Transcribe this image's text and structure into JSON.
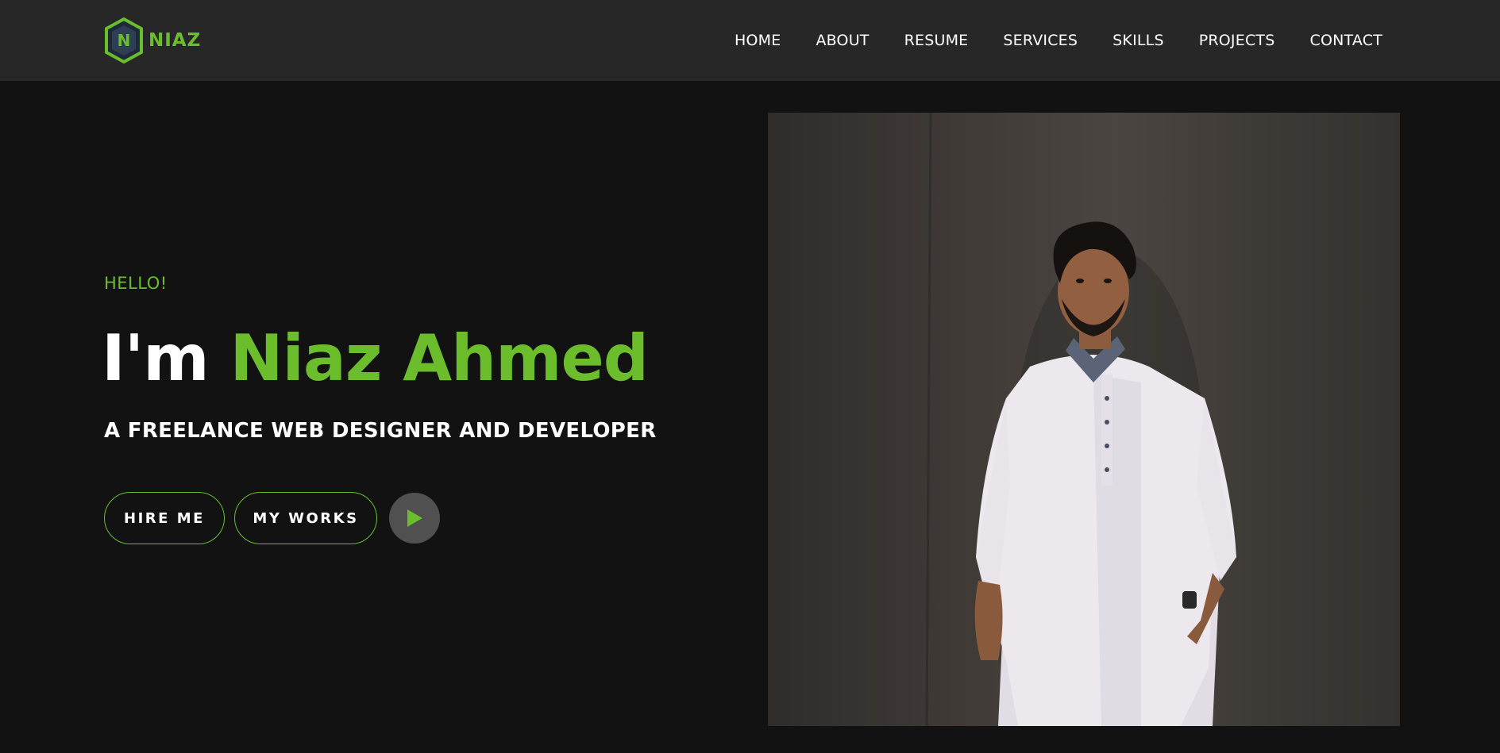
{
  "brand": {
    "logo_letter": "N",
    "name": "NIAZ",
    "accent_color": "#6bbd2c"
  },
  "nav": {
    "items": [
      {
        "label": "HOME"
      },
      {
        "label": "ABOUT"
      },
      {
        "label": "RESUME"
      },
      {
        "label": "SERVICES"
      },
      {
        "label": "SKILLS"
      },
      {
        "label": "PROJECTS"
      },
      {
        "label": "CONTACT"
      }
    ]
  },
  "hero": {
    "greeting": "HELLO!",
    "headline_prefix": "I'm",
    "headline_name": "Niaz Ahmed",
    "subtitle": "A FREELANCE WEB DESIGNER AND DEVELOPER",
    "hire_label": "HIRE ME",
    "works_label": "MY WORKS",
    "play_icon": "play-icon"
  },
  "photo": {
    "icon": "portrait-photo"
  }
}
